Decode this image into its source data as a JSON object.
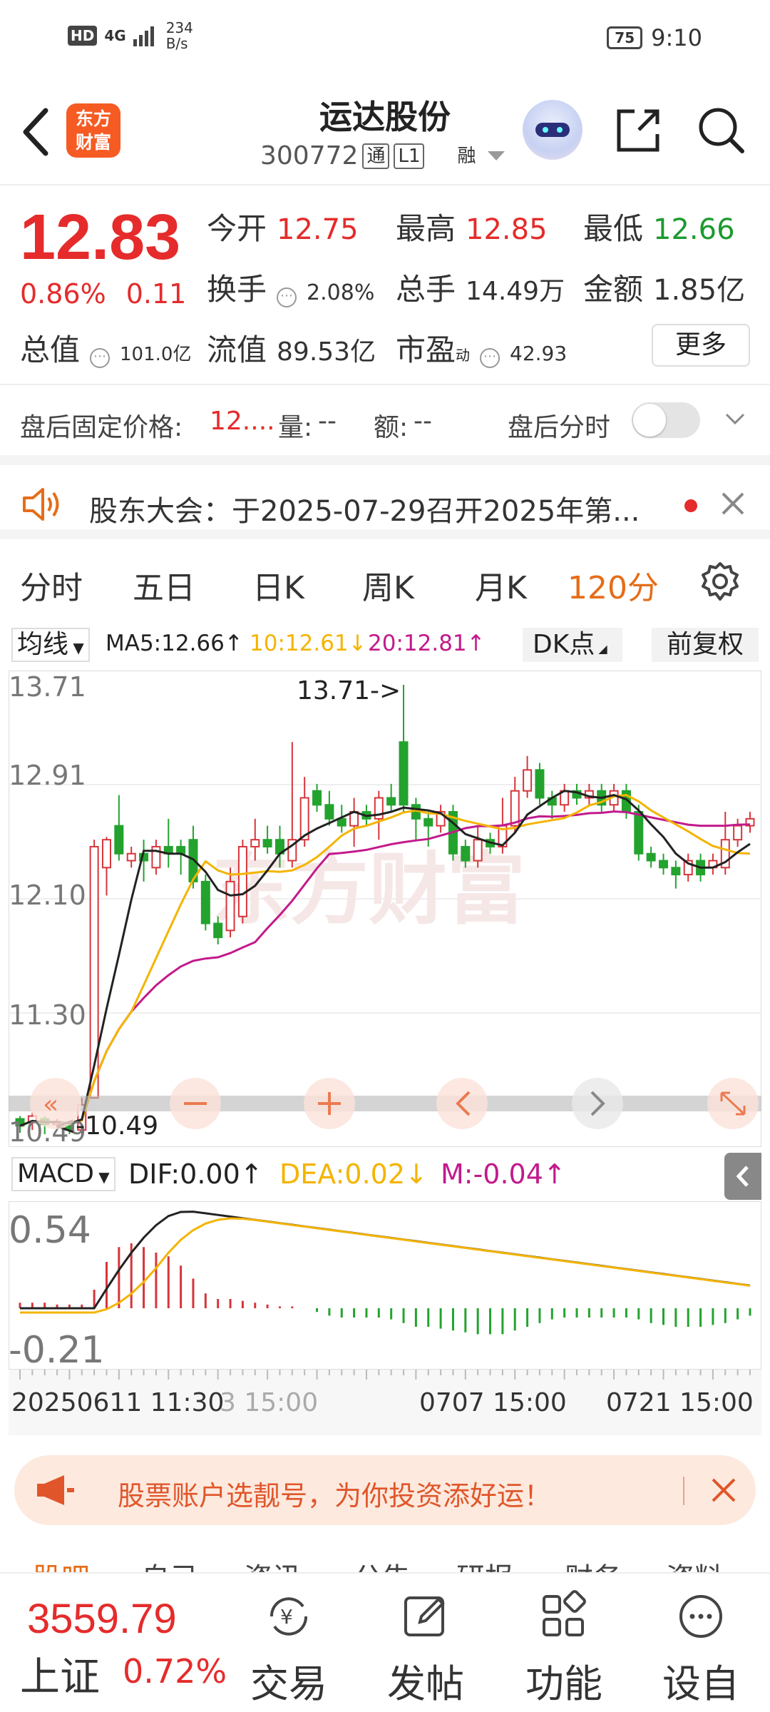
{
  "status_bar": {
    "hd": "HD",
    "signal": "4G",
    "net_speed": "234",
    "net_unit": "B/s",
    "battery": "75",
    "time": "9:10"
  },
  "header": {
    "brand_logo_line1": "东方",
    "brand_logo_line2": "财富",
    "stock_name": "运达股份",
    "stock_code": "300772",
    "tags": [
      "通",
      "L1",
      "融"
    ]
  },
  "quote": {
    "price": "12.83",
    "change_pct": "0.86%",
    "change_abs": "0.11",
    "open_label": "今开",
    "open": "12.75",
    "high_label": "最高",
    "high": "12.85",
    "low_label": "最低",
    "low": "12.66",
    "turnover_label": "换手",
    "turnover": "2.08%",
    "volume_label": "总手",
    "volume": "14.49万",
    "amount_label": "金额",
    "amount": "1.85亿",
    "total_mv_label": "总值",
    "total_mv": "101.0亿",
    "float_mv_label": "流值",
    "float_mv": "89.53亿",
    "pe_label": "市盈",
    "pe_sup": "动",
    "pe": "42.93",
    "more_label": "更多"
  },
  "after_hours": {
    "price_label": "盘后固定价格:",
    "price_value": "12....",
    "vol_label": "量:",
    "vol_value": "--",
    "amt_label": "额:",
    "amt_value": "--",
    "intraday_label": "盘后分时"
  },
  "notice": {
    "text": "股东大会：于2025-07-29召开2025年第..."
  },
  "period_tabs": [
    "分时",
    "五日",
    "日K",
    "周K",
    "月K",
    "120分"
  ],
  "active_period_index": 5,
  "ma_bar": {
    "selector": "均线",
    "ma5": "MA5:12.66↑",
    "ma10": "10:12.61↓",
    "ma20": "20:12.81↑",
    "dk_label": "DK点",
    "adjust_label": "前复权"
  },
  "kchart": {
    "y_labels": [
      "13.71",
      "12.91",
      "12.10",
      "11.30",
      "10.49"
    ],
    "max_annot": "13.71->",
    "min_annot": "<-10.49",
    "watermark": "东方财富",
    "colors": {
      "up": "#d6353b",
      "down": "#23a32e",
      "ma5": "#222222",
      "ma10": "#f4b400",
      "ma20": "#c21a8c"
    }
  },
  "macd_bar": {
    "selector": "MACD",
    "dif": "DIF:0.00↑",
    "dea": "DEA:0.02↓",
    "m": "M:-0.04↑",
    "y_labels": [
      "0.54",
      "-0.21"
    ]
  },
  "xaxis": {
    "labels": [
      "20250611 11:30",
      "3 15:00",
      "0707 15:00",
      "0721 15:00"
    ]
  },
  "ad": {
    "text": "股票账户选靓号，为你投资添好运！"
  },
  "bottom_nav": {
    "index_value": "3559.79",
    "index_name": "上证",
    "index_change": "0.72%",
    "items": [
      "交易",
      "发帖",
      "功能",
      "设自选"
    ]
  },
  "under_tabs": [
    "股吧",
    "自己",
    "资讯",
    "公告",
    "研报",
    "财务",
    "资料"
  ]
}
